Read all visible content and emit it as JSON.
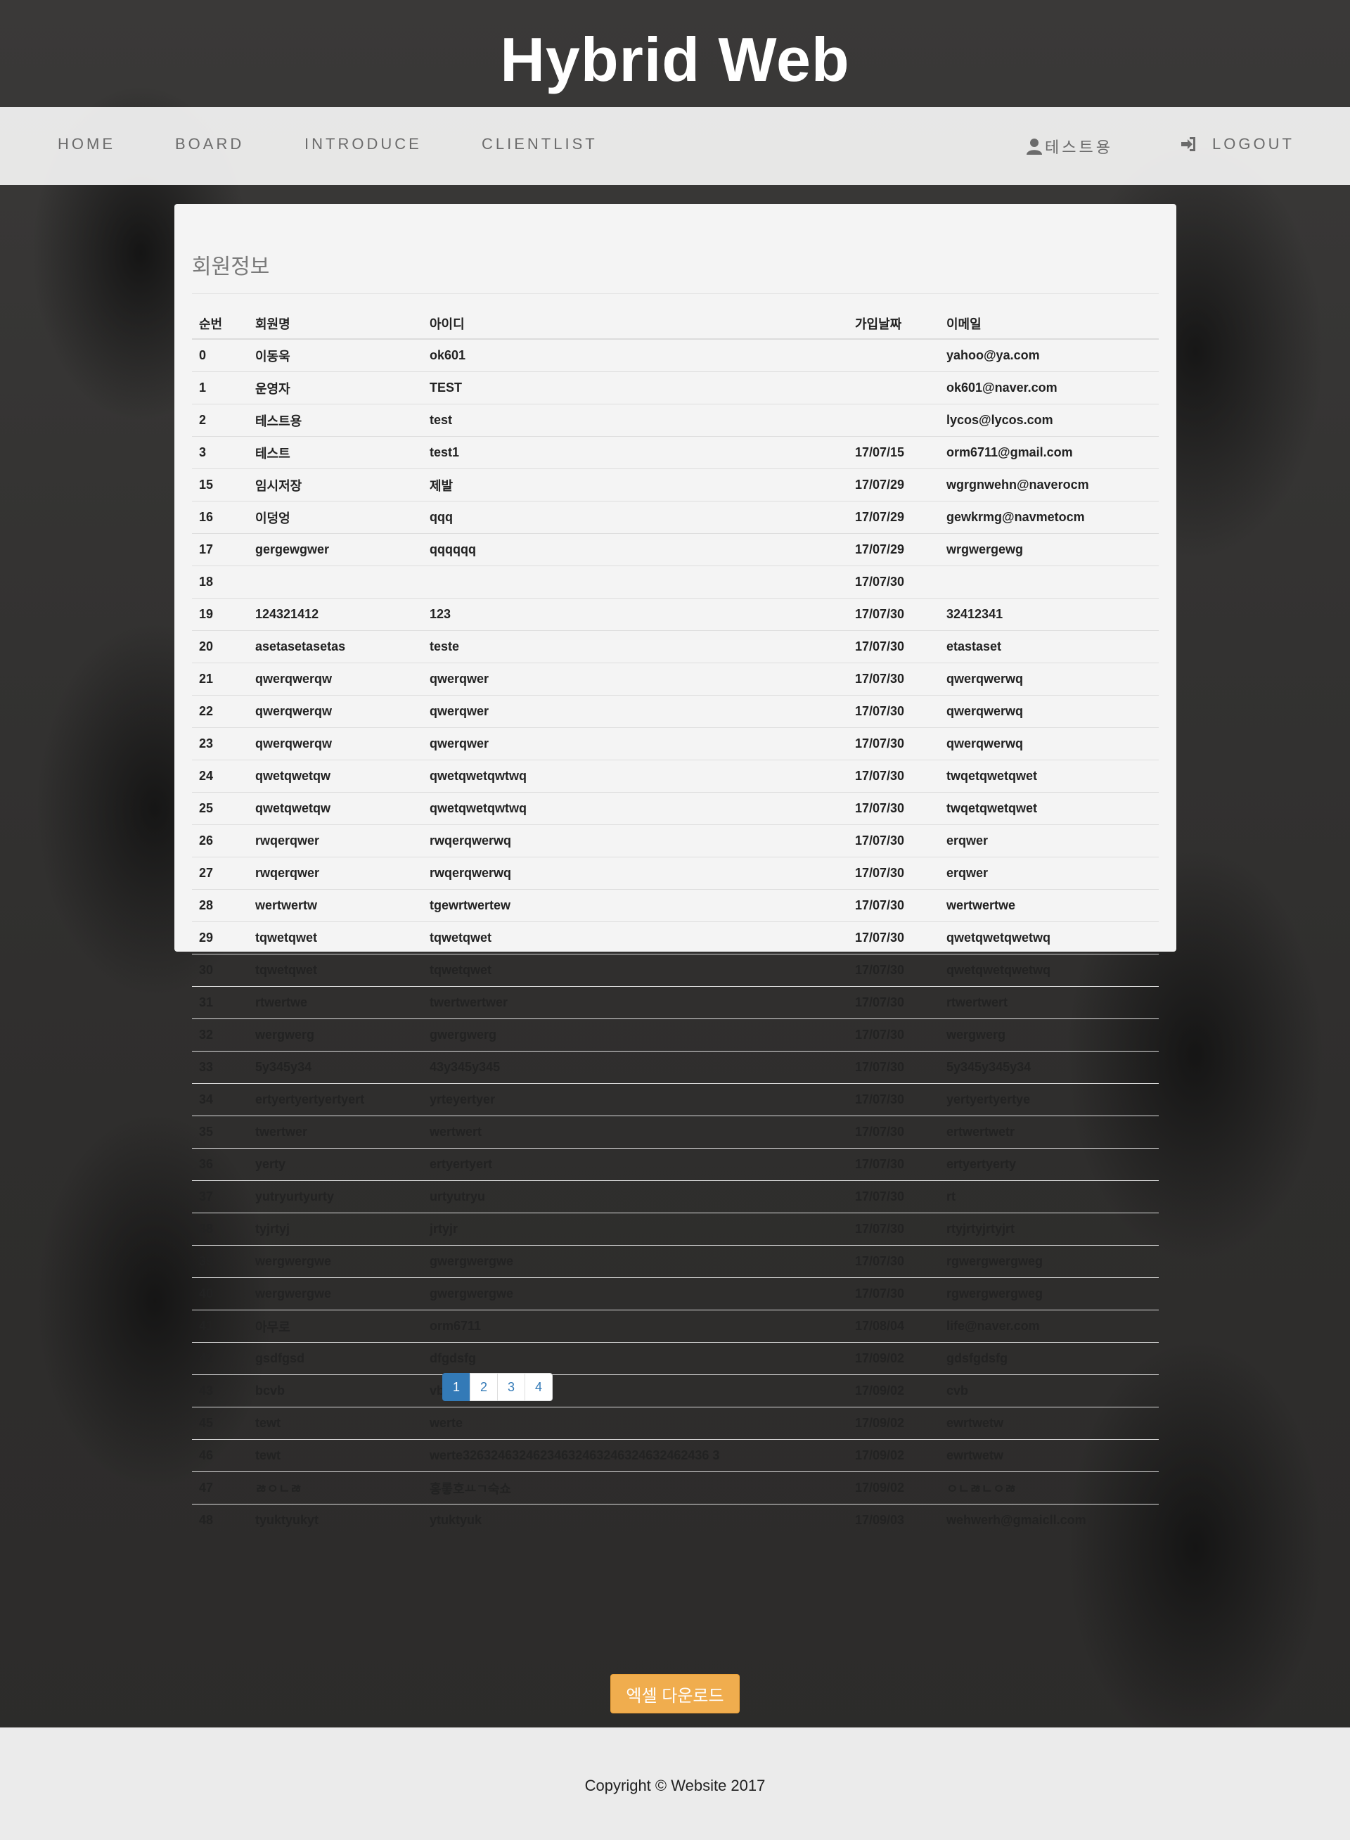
{
  "header": {
    "title": "Hybrid Web"
  },
  "nav": {
    "home": "HOME",
    "board": "BOARD",
    "introduce": "INTRODUCE",
    "clientlist": "CLIENTLIST",
    "user": "테스트용",
    "logout": "LOGOUT"
  },
  "panel": {
    "title": "회원정보"
  },
  "table": {
    "headers": {
      "no": "순번",
      "name": "회원명",
      "id": "아이디",
      "date": "가입날짜",
      "email": "이메일"
    },
    "rows": [
      {
        "no": "0",
        "name": "이동욱",
        "id": "ok601",
        "date": "",
        "email": "yahoo@ya.com"
      },
      {
        "no": "1",
        "name": "운영자",
        "id": "TEST",
        "date": "",
        "email": "ok601@naver.com"
      },
      {
        "no": "2",
        "name": "테스트용",
        "id": "test",
        "date": "",
        "email": "lycos@lycos.com"
      },
      {
        "no": "3",
        "name": "테스트",
        "id": "test1",
        "date": "17/07/15",
        "email": "orm6711@gmail.com"
      },
      {
        "no": "15",
        "name": "임시저장",
        "id": "제발",
        "date": "17/07/29",
        "email": "wgrgnwehn@naverocm"
      },
      {
        "no": "16",
        "name": "이덩엉",
        "id": "qqq",
        "date": "17/07/29",
        "email": "gewkrmg@navmetocm"
      },
      {
        "no": "17",
        "name": "gergewgwer",
        "id": "qqqqqq",
        "date": "17/07/29",
        "email": "wrgwergewg"
      },
      {
        "no": "18",
        "name": "",
        "id": "",
        "date": "17/07/30",
        "email": ""
      },
      {
        "no": "19",
        "name": "124321412",
        "id": "123",
        "date": "17/07/30",
        "email": "32412341"
      },
      {
        "no": "20",
        "name": "asetasetasetas",
        "id": "teste",
        "date": "17/07/30",
        "email": "etastaset"
      },
      {
        "no": "21",
        "name": "qwerqwerqw",
        "id": "qwerqwer",
        "date": "17/07/30",
        "email": "qwerqwerwq"
      },
      {
        "no": "22",
        "name": "qwerqwerqw",
        "id": "qwerqwer",
        "date": "17/07/30",
        "email": "qwerqwerwq"
      },
      {
        "no": "23",
        "name": "qwerqwerqw",
        "id": "qwerqwer",
        "date": "17/07/30",
        "email": "qwerqwerwq"
      },
      {
        "no": "24",
        "name": "qwetqwetqw",
        "id": "qwetqwetqwtwq",
        "date": "17/07/30",
        "email": "twqetqwetqwet"
      },
      {
        "no": "25",
        "name": "qwetqwetqw",
        "id": "qwetqwetqwtwq",
        "date": "17/07/30",
        "email": "twqetqwetqwet"
      },
      {
        "no": "26",
        "name": "rwqerqwer",
        "id": "rwqerqwerwq",
        "date": "17/07/30",
        "email": "erqwer"
      },
      {
        "no": "27",
        "name": "rwqerqwer",
        "id": "rwqerqwerwq",
        "date": "17/07/30",
        "email": "erqwer"
      },
      {
        "no": "28",
        "name": "wertwertw",
        "id": "tgewrtwertew",
        "date": "17/07/30",
        "email": "wertwertwe"
      },
      {
        "no": "29",
        "name": "tqwetqwet",
        "id": "tqwetqwet",
        "date": "17/07/30",
        "email": "qwetqwetqwetwq"
      },
      {
        "no": "30",
        "name": "tqwetqwet",
        "id": "tqwetqwet",
        "date": "17/07/30",
        "email": "qwetqwetqwetwq"
      },
      {
        "no": "31",
        "name": "rtwertwe",
        "id": "twertwertwer",
        "date": "17/07/30",
        "email": "rtwertwert"
      },
      {
        "no": "32",
        "name": "wergwerg",
        "id": "gwergwerg",
        "date": "17/07/30",
        "email": "wergwerg"
      },
      {
        "no": "33",
        "name": "5y345y34",
        "id": "43y345y345",
        "date": "17/07/30",
        "email": "5y345y345y34"
      },
      {
        "no": "34",
        "name": "ertyertyertyertyert",
        "id": "yrteyertyer",
        "date": "17/07/30",
        "email": "yertyertyertye"
      },
      {
        "no": "35",
        "name": "twertwer",
        "id": "wertwert",
        "date": "17/07/30",
        "email": "ertwertwetr"
      },
      {
        "no": "36",
        "name": "yerty",
        "id": "ertyertyert",
        "date": "17/07/30",
        "email": "ertyertyerty"
      },
      {
        "no": "37",
        "name": "yutryurtyurty",
        "id": "urtyutryu",
        "date": "17/07/30",
        "email": "rt"
      },
      {
        "no": "38",
        "name": "tyjrtyj",
        "id": "jrtyjr",
        "date": "17/07/30",
        "email": "rtyjrtyjrtyjrt"
      },
      {
        "no": "39",
        "name": "wergwergwe",
        "id": "gwergwergwe",
        "date": "17/07/30",
        "email": "rgwergwergweg"
      },
      {
        "no": "40",
        "name": "wergwergwe",
        "id": "gwergwergwe",
        "date": "17/07/30",
        "email": "rgwergwergweg"
      },
      {
        "no": "41",
        "name": "아무로",
        "id": "orm6711",
        "date": "17/08/04",
        "email": "life@naver.com"
      },
      {
        "no": "42",
        "name": "gsdfgsd",
        "id": "dfgdsfg",
        "date": "17/09/02",
        "email": "gdsfgdsfg"
      },
      {
        "no": "43",
        "name": "bcvb",
        "id": "vb",
        "date": "17/09/02",
        "email": "cvb"
      },
      {
        "no": "45",
        "name": "tewt",
        "id": "werte",
        "date": "17/09/02",
        "email": "ewrtwetw"
      },
      {
        "no": "46",
        "name": "tewt",
        "id": "werte32632463246234632463246324632462436 3",
        "date": "17/09/02",
        "email": "ewrtwetw"
      },
      {
        "no": "47",
        "name": "ㅀㅇㄴㅀ",
        "id": "홍롷호ㅛㄱ숙쇼",
        "date": "17/09/02",
        "email": "ㅇㄴㅀㄴㅇㅀ"
      },
      {
        "no": "48",
        "name": "tyuktyukyt",
        "id": "ytuktyuk",
        "date": "17/09/03",
        "email": "wehwerh@gmaicll.com"
      }
    ]
  },
  "pagination": {
    "pages": [
      "1",
      "2",
      "3",
      "4"
    ],
    "active": "1"
  },
  "excel_button": "엑셀 다운로드",
  "footer": {
    "copyright": "Copyright © Website 2017"
  },
  "colors": {
    "accent": "#337ab7",
    "warning": "#f0ad4e"
  }
}
